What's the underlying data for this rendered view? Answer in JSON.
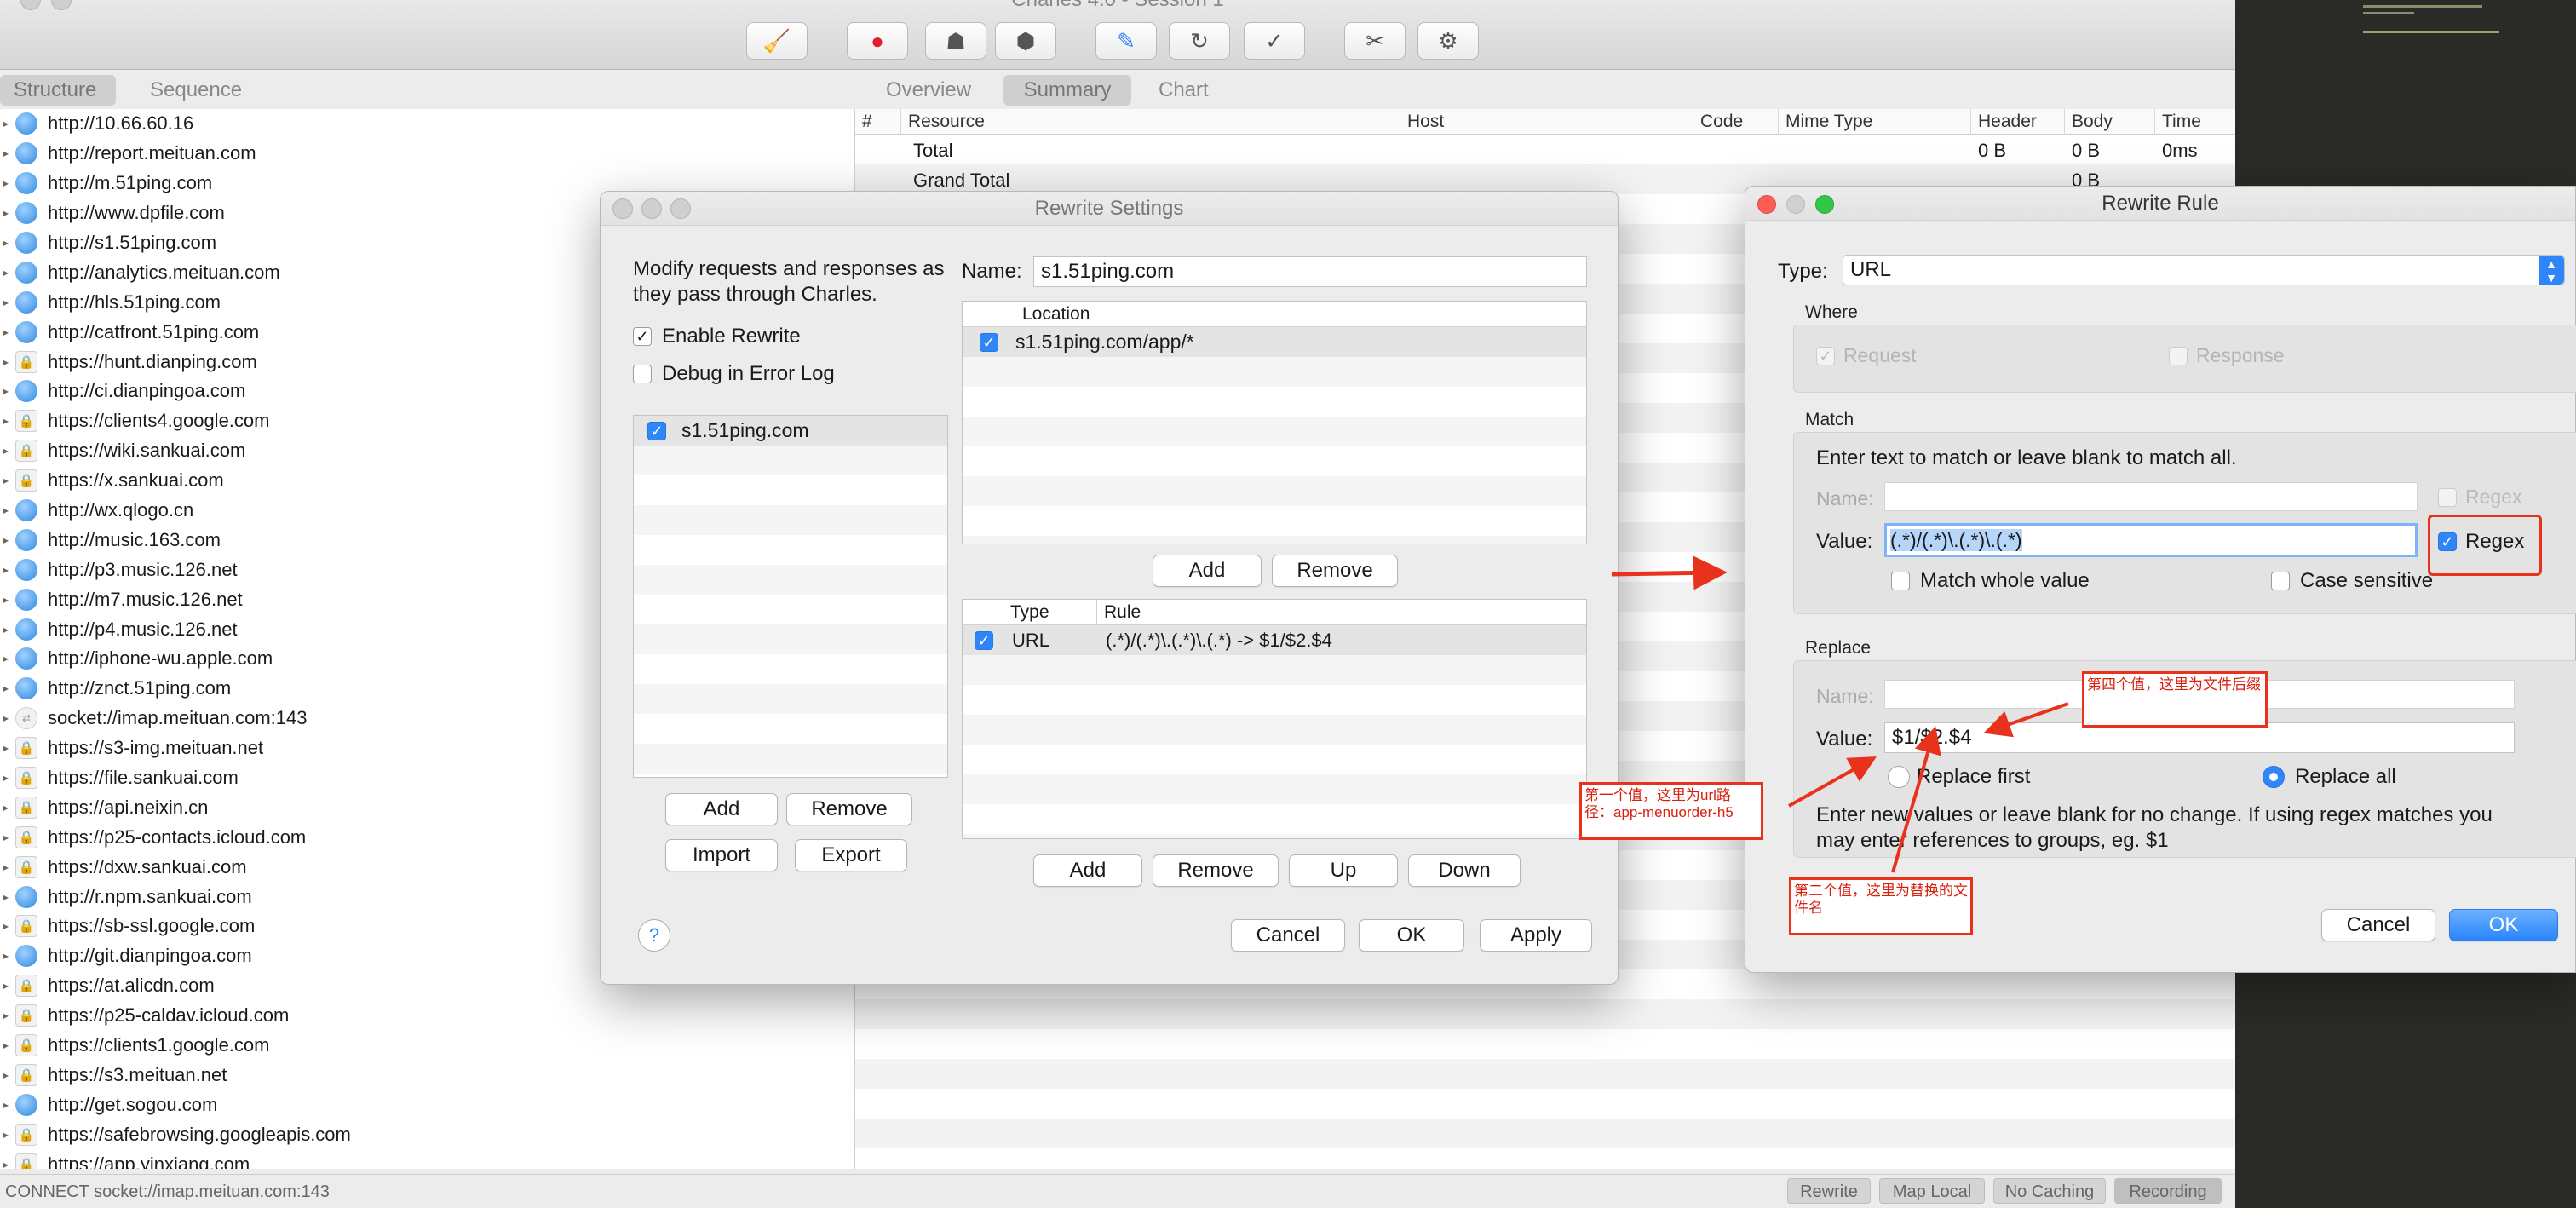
{
  "app": {
    "window_title": "Charles 4.0 - Session 1"
  },
  "toolbar": {
    "buttons": [
      {
        "icon": "broom-icon",
        "glyph": "🧹"
      },
      {
        "icon": "record-icon",
        "glyph": "●"
      },
      {
        "icon": "throttle-turtle-icon",
        "glyph": "☗"
      },
      {
        "icon": "breakpoints-stop-icon",
        "glyph": "⬢"
      },
      {
        "icon": "compose-pen-icon",
        "glyph": "✎"
      },
      {
        "icon": "repeat-icon",
        "glyph": "↻"
      },
      {
        "icon": "validate-check-icon",
        "glyph": "✓"
      },
      {
        "icon": "tools-icon",
        "glyph": "✂"
      },
      {
        "icon": "settings-gear-icon",
        "glyph": "⚙"
      }
    ]
  },
  "left": {
    "tabs": [
      {
        "label": "Structure",
        "active": true
      },
      {
        "label": "Sequence",
        "active": false
      }
    ],
    "hosts": [
      {
        "url": "http://10.66.60.16",
        "icon": "globe"
      },
      {
        "url": "http://report.meituan.com",
        "icon": "globe"
      },
      {
        "url": "http://m.51ping.com",
        "icon": "globe"
      },
      {
        "url": "http://www.dpfile.com",
        "icon": "globe"
      },
      {
        "url": "http://s1.51ping.com",
        "icon": "globe"
      },
      {
        "url": "http://analytics.meituan.com",
        "icon": "globe"
      },
      {
        "url": "http://hls.51ping.com",
        "icon": "globe"
      },
      {
        "url": "http://catfront.51ping.com",
        "icon": "globe"
      },
      {
        "url": "https://hunt.dianping.com",
        "icon": "lock"
      },
      {
        "url": "http://ci.dianpingoa.com",
        "icon": "globe"
      },
      {
        "url": "https://clients4.google.com",
        "icon": "lock"
      },
      {
        "url": "https://wiki.sankuai.com",
        "icon": "lock"
      },
      {
        "url": "https://x.sankuai.com",
        "icon": "lock"
      },
      {
        "url": "http://wx.qlogo.cn",
        "icon": "globe"
      },
      {
        "url": "http://music.163.com",
        "icon": "globe"
      },
      {
        "url": "http://p3.music.126.net",
        "icon": "globe"
      },
      {
        "url": "http://m7.music.126.net",
        "icon": "globe"
      },
      {
        "url": "http://p4.music.126.net",
        "icon": "globe"
      },
      {
        "url": "http://iphone-wu.apple.com",
        "icon": "globe"
      },
      {
        "url": "http://znct.51ping.com",
        "icon": "globe"
      },
      {
        "url": "socket://imap.meituan.com:143",
        "icon": "sock"
      },
      {
        "url": "https://s3-img.meituan.net",
        "icon": "lock"
      },
      {
        "url": "https://file.sankuai.com",
        "icon": "lock"
      },
      {
        "url": "https://api.neixin.cn",
        "icon": "lock"
      },
      {
        "url": "https://p25-contacts.icloud.com",
        "icon": "lock"
      },
      {
        "url": "https://dxw.sankuai.com",
        "icon": "lock"
      },
      {
        "url": "http://r.npm.sankuai.com",
        "icon": "globe"
      },
      {
        "url": "https://sb-ssl.google.com",
        "icon": "lock"
      },
      {
        "url": "http://git.dianpingoa.com",
        "icon": "globe"
      },
      {
        "url": "https://at.alicdn.com",
        "icon": "lock"
      },
      {
        "url": "https://p25-caldav.icloud.com",
        "icon": "lock"
      },
      {
        "url": "https://clients1.google.com",
        "icon": "lock"
      },
      {
        "url": "https://s3.meituan.net",
        "icon": "lock"
      },
      {
        "url": "http://get.sogou.com",
        "icon": "globe"
      },
      {
        "url": "https://safebrowsing.googleapis.com",
        "icon": "lock"
      },
      {
        "url": "https://app.yinxiang.com",
        "icon": "lock"
      }
    ]
  },
  "right": {
    "tabs": [
      {
        "label": "Overview",
        "active": false
      },
      {
        "label": "Summary",
        "active": true
      },
      {
        "label": "Chart",
        "active": false
      }
    ],
    "columns": [
      "#",
      "Resource",
      "Host",
      "Code",
      "Mime Type",
      "Header",
      "Body",
      "Time"
    ],
    "rows": [
      {
        "resource": "Total",
        "header": "0 B",
        "body": "0 B",
        "time": "0ms"
      },
      {
        "resource": "Grand Total",
        "header": "",
        "body": "0 B",
        "time": ""
      }
    ]
  },
  "status": {
    "text": "CONNECT socket://imap.meituan.com:143",
    "buttons": [
      "Rewrite",
      "Map Local",
      "No Caching",
      "Recording"
    ]
  },
  "rewrite_settings": {
    "title": "Rewrite Settings",
    "description": "Modify requests and responses as they pass through Charles.",
    "enable_rewrite": "Enable Rewrite",
    "debug_log": "Debug in Error Log",
    "sets": [
      "s1.51ping.com"
    ],
    "set_buttons": {
      "add": "Add",
      "remove": "Remove",
      "import": "Import",
      "export": "Export"
    },
    "name_label": "Name:",
    "name_value": "s1.51ping.com",
    "location_header": "Location",
    "locations": [
      "s1.51ping.com/app/*"
    ],
    "location_buttons": {
      "add": "Add",
      "remove": "Remove"
    },
    "rules_headers": {
      "type": "Type",
      "rule": "Rule"
    },
    "rules": [
      {
        "type": "URL",
        "rule": "(.*)/(.*)\\.(.*)\\.(.*) -> $1/$2.$4"
      }
    ],
    "rule_buttons": {
      "add": "Add",
      "remove": "Remove",
      "up": "Up",
      "down": "Down"
    },
    "help": "?",
    "footer": {
      "cancel": "Cancel",
      "ok": "OK",
      "apply": "Apply"
    }
  },
  "rewrite_rule": {
    "title": "Rewrite Rule",
    "type_label": "Type:",
    "type_value": "URL",
    "where_label": "Where",
    "request": "Request",
    "response": "Response",
    "match_label": "Match",
    "match_hint": "Enter text to match or leave blank to match all.",
    "name_label": "Name:",
    "value_label": "Value:",
    "regex": "Regex",
    "match_value": "(.*)/(.*)\\.(.*)\\.(.*)",
    "match_whole": "Match whole value",
    "case_sensitive": "Case sensitive",
    "replace_label": "Replace",
    "replace_value": "$1/$2.$4",
    "replace_first": "Replace first",
    "replace_all": "Replace all",
    "replace_hint": "Enter new values or leave blank for no change. If using regex matches you may enter references to groups, eg. $1",
    "help": "?",
    "cancel": "Cancel",
    "ok": "OK"
  },
  "annotations": {
    "fourth_value": "第四个值，这里为文件后缀",
    "first_value": "第一个值，这里为url路径：app-menuorder-h5",
    "second_value": "第二个值，这里为替换的文件名"
  },
  "colors": {
    "accent_blue": "#2f86f9",
    "annotation_red": "#e8321c",
    "dark_panel": "#2a2b26"
  }
}
